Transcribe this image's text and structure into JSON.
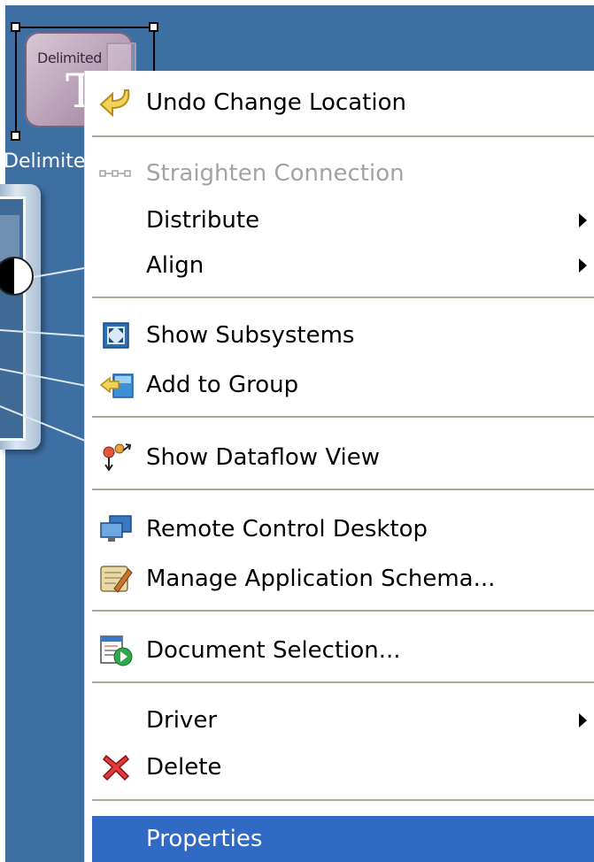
{
  "canvas": {
    "node": {
      "tile_title": "Delimited",
      "tile_big": "Te",
      "label": "Delimite"
    },
    "colors": {
      "background": "#3e6fa3",
      "menu_highlight": "#316ac5"
    }
  },
  "context_menu": {
    "items": [
      {
        "label": "Undo Change Location",
        "icon": "undo-arrow-icon",
        "enabled": true
      },
      {
        "label": "Straighten Connection",
        "icon": "straighten-connection-icon",
        "enabled": false
      },
      {
        "label": "Distribute",
        "submenu": true
      },
      {
        "label": "Align",
        "submenu": true
      },
      {
        "label": "Show Subsystems",
        "icon": "subsystems-icon"
      },
      {
        "label": "Add to Group",
        "icon": "add-to-group-icon"
      },
      {
        "label": "Show Dataflow View",
        "icon": "dataflow-icon"
      },
      {
        "label": "Remote Control Desktop",
        "icon": "remote-desktop-icon"
      },
      {
        "label": "Manage Application Schema...",
        "icon": "schema-icon"
      },
      {
        "label": "Document Selection...",
        "icon": "document-selection-icon"
      },
      {
        "label": "Driver",
        "submenu": true
      },
      {
        "label": "Delete",
        "icon": "delete-x-icon"
      },
      {
        "label": "Properties",
        "selected": true
      }
    ]
  }
}
